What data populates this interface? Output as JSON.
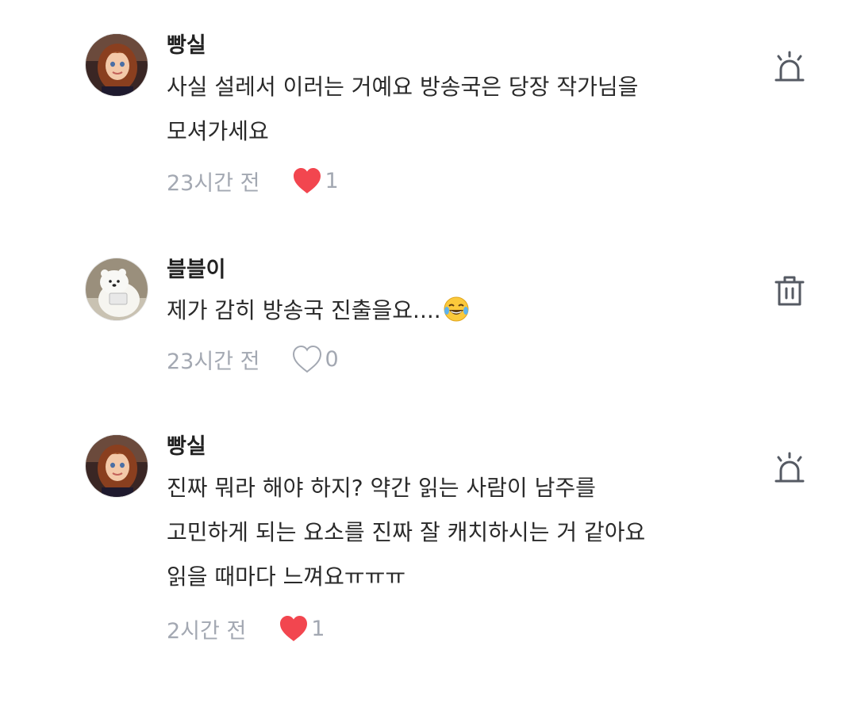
{
  "comments": [
    {
      "author": "빵실",
      "lines": [
        "사실 설레서 이러는 거예요 방송국은 당장 작가님을",
        "모셔가세요"
      ],
      "time": "23시간 전",
      "liked": true,
      "likes": "1",
      "action_icon": "report-siren-icon"
    },
    {
      "author": "블블이",
      "lines": [
        "제가 감히 방송국 진출을요...."
      ],
      "emoji": "tears-of-joy-emoji",
      "time": "23시간 전",
      "liked": false,
      "likes": "0",
      "action_icon": "trash-icon"
    },
    {
      "author": "빵실",
      "lines": [
        "진짜 뭐라 해야 하지? 약간 읽는 사람이 남주를",
        "고민하게 되는 요소를 진짜 잘 캐치하시는 거 같아요",
        "읽을 때마다 느껴요ㅠㅠㅠ"
      ],
      "time": "2시간 전",
      "liked": true,
      "likes": "1",
      "action_icon": "report-siren-icon"
    }
  ],
  "colors": {
    "heart_filled": "#f2464f",
    "meta_gray": "#a3a8b2",
    "icon_gray": "#555a63"
  }
}
